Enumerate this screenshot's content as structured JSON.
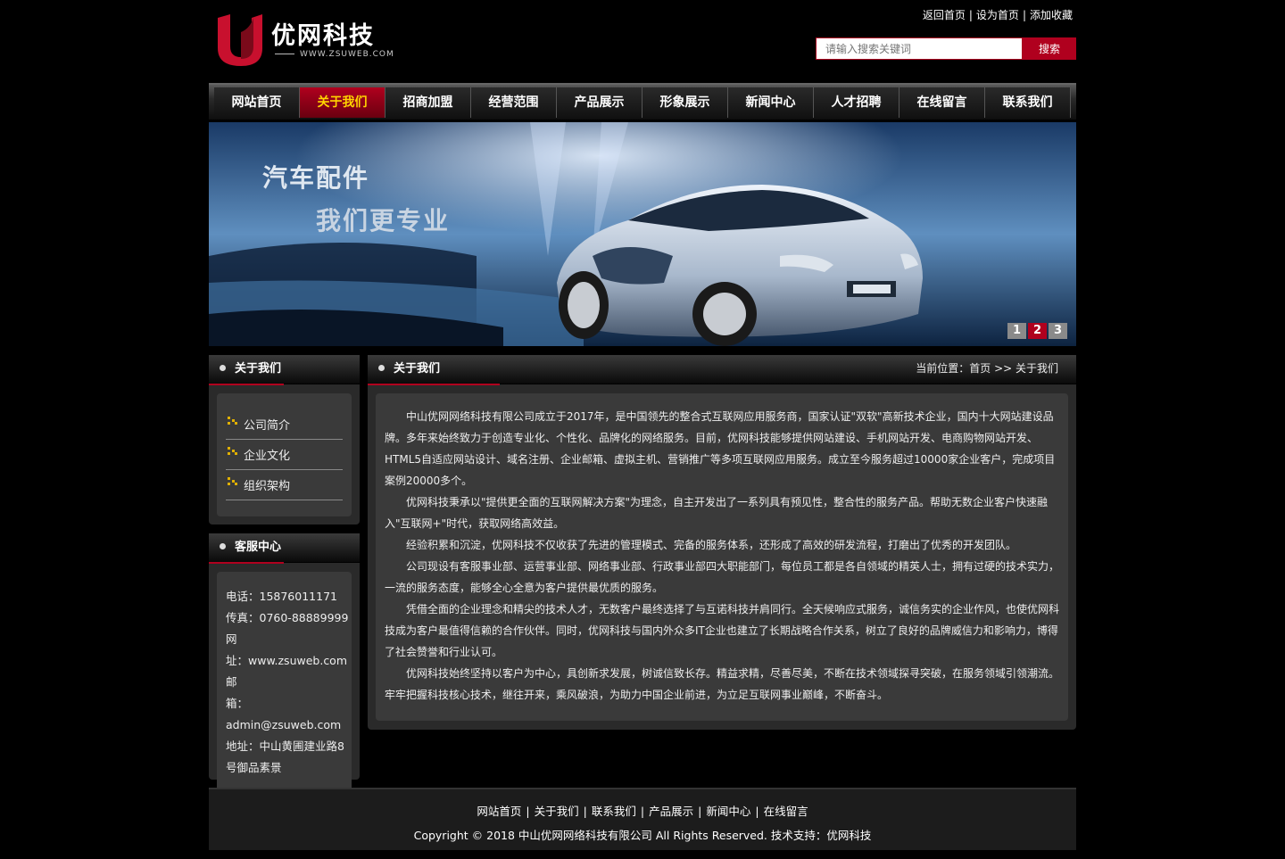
{
  "brand": {
    "name": "优网科技",
    "site": "WWW.ZSUWEB.COM"
  },
  "toplinks": [
    "返回首页",
    "设为首页",
    "添加收藏"
  ],
  "search": {
    "placeholder": "请输入搜索关键词",
    "button": "搜索"
  },
  "nav": {
    "items": [
      "网站首页",
      "关于我们",
      "招商加盟",
      "经营范围",
      "产品展示",
      "形象展示",
      "新闻中心",
      "人才招聘",
      "在线留言",
      "联系我们"
    ],
    "active_index": 1
  },
  "banner": {
    "line1": "汽车配件",
    "line2": "我们更专业",
    "pages": [
      "1",
      "2",
      "3"
    ],
    "active_page": 1
  },
  "sidebar": {
    "about": {
      "title": "关于我们",
      "items": [
        "公司简介",
        "企业文化",
        "组织架构"
      ]
    },
    "service": {
      "title": "客服中心",
      "lines": [
        "电话：15876011171",
        "传真：0760-88889999",
        "网",
        "址：www.zsuweb.com",
        "邮",
        "箱：admin@zsuweb.com",
        "地址：中山黄圃建业路8",
        "号御品素景"
      ]
    }
  },
  "main": {
    "title": "关于我们",
    "breadcrumb": "当前位置：首页 >> 关于我们",
    "paragraphs": [
      "中山优网网络科技有限公司成立于2017年，是中国领先的整合式互联网应用服务商，国家认证\"双软\"高新技术企业，国内十大网站建设品牌。多年来始终致力于创造专业化、个性化、品牌化的网络服务。目前，优网科技能够提供网站建设、手机网站开发、电商购物网站开发、HTML5自适应网站设计、域名注册、企业邮箱、虚拟主机、营销推广等多项互联网应用服务。成立至今服务超过10000家企业客户，完成项目案例20000多个。",
      "优网科技秉承以\"提供更全面的互联网解决方案\"为理念，自主开发出了一系列具有预见性，整合性的服务产品。帮助无数企业客户快速融入\"互联网+\"时代，获取网络高效益。",
      "经验积累和沉淀，优网科技不仅收获了先进的管理模式、完备的服务体系，还形成了高效的研发流程，打磨出了优秀的开发团队。",
      "公司现设有客服事业部、运营事业部、网络事业部、行政事业部四大职能部门，每位员工都是各自领域的精英人士，拥有过硬的技术实力，一流的服务态度，能够全心全意为客户提供最优质的服务。",
      "凭借全面的企业理念和精尖的技术人才，无数客户最终选择了与互诺科技并肩同行。全天候响应式服务，诚信务实的企业作风，也使优网科技成为客户最值得信赖的合作伙伴。同时，优网科技与国内外众多IT企业也建立了长期战略合作关系，树立了良好的品牌威信力和影响力，博得了社会赞誉和行业认可。",
      "优网科技始终坚持以客户为中心，具创新求发展，树诚信致长存。精益求精，尽善尽美，不断在技术领域探寻突破，在服务领域引领潮流。牢牢把握科技核心技术，继往开来，乘风破浪，为助力中国企业前进，为立足互联网事业巅峰，不断奋斗。"
    ]
  },
  "footer": {
    "links": [
      "网站首页",
      "关于我们",
      "联系我们",
      "产品展示",
      "新闻中心",
      "在线留言"
    ],
    "copyright": "Copyright © 2018 中山优网网络科技有限公司 All Rights Reserved.  技术支持：优网科技"
  },
  "colors": {
    "accent": "#b0001e",
    "nav_active_text": "#ffd400"
  }
}
